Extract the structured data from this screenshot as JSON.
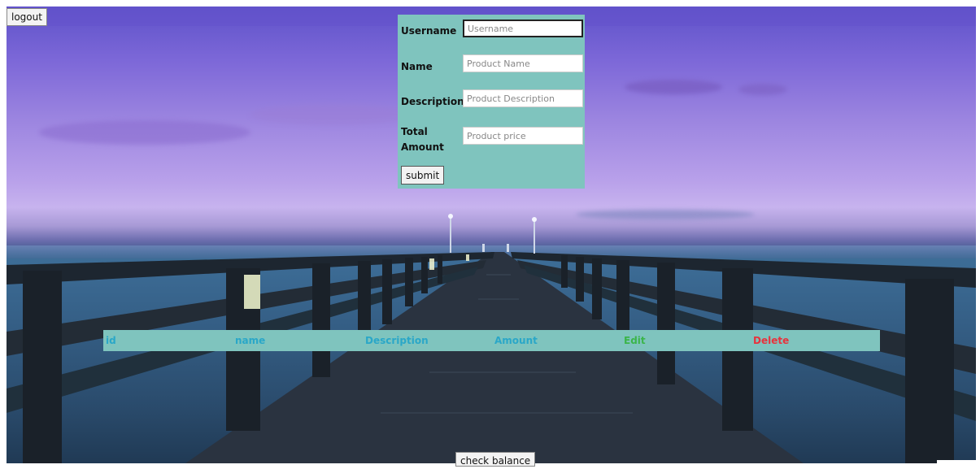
{
  "header": {
    "logout_label": "logout"
  },
  "form": {
    "username_label": "Username",
    "username_placeholder": "Username",
    "name_label": "Name",
    "name_placeholder": "Product Name",
    "description_label": "Description",
    "description_placeholder": "Product Description",
    "amount_label": "Total Amount",
    "amount_placeholder": "Product price",
    "submit_label": "submit"
  },
  "table": {
    "columns": [
      {
        "label": "id",
        "color": "#2aa7c8"
      },
      {
        "label": "name",
        "color": "#2aa7c8"
      },
      {
        "label": "Description",
        "color": "#2aa7c8"
      },
      {
        "label": "Amount",
        "color": "#2aa7c8"
      },
      {
        "label": "Edit",
        "color": "#3bb54a"
      },
      {
        "label": "Delete",
        "color": "#e8323c"
      }
    ]
  },
  "footer": {
    "check_balance_label": "check balance"
  },
  "colors": {
    "panel": "#7fc4be"
  }
}
